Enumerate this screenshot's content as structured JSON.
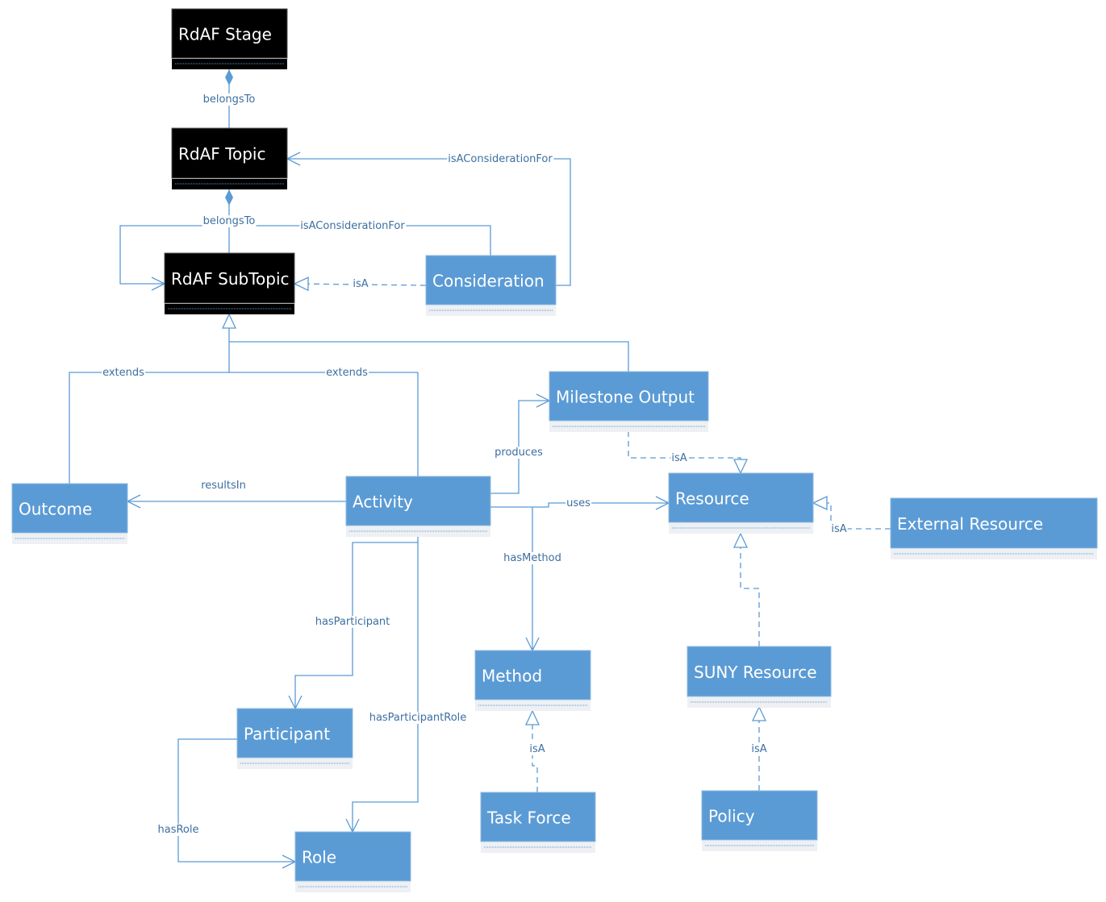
{
  "colors": {
    "dark_class": "#000000",
    "light_class": "#5b9bd5",
    "edge": "#5b9bd5",
    "label": "#3c6fa0"
  },
  "nodes": {
    "stage": {
      "name": "RdAF Stage",
      "style": "dark"
    },
    "topic": {
      "name": "RdAF Topic",
      "style": "dark"
    },
    "subtopic": {
      "name": "RdAF SubTopic",
      "style": "dark"
    },
    "consideration": {
      "name": "Consideration",
      "style": "light"
    },
    "milestone": {
      "name": "Milestone Output",
      "style": "light"
    },
    "outcome": {
      "name": "Outcome",
      "style": "light"
    },
    "activity": {
      "name": "Activity",
      "style": "light"
    },
    "resource": {
      "name": "Resource",
      "style": "light"
    },
    "external": {
      "name": "External Resource",
      "style": "light"
    },
    "method": {
      "name": "Method",
      "style": "light"
    },
    "suny": {
      "name": "SUNY Resource",
      "style": "light"
    },
    "participant": {
      "name": "Participant",
      "style": "light"
    },
    "taskforce": {
      "name": "Task Force",
      "style": "light"
    },
    "policy": {
      "name": "Policy",
      "style": "light"
    },
    "role": {
      "name": "Role",
      "style": "light"
    }
  },
  "edges": {
    "topic_stage": {
      "label": "belongsTo",
      "type": "composition"
    },
    "subtopic_topic": {
      "label": "belongsTo",
      "type": "composition"
    },
    "consid_topic": {
      "label": "isAConsiderationFor",
      "type": "association"
    },
    "consid_subtopic": {
      "label": "isAConsiderationFor",
      "type": "association"
    },
    "consid_isa": {
      "label": "isA",
      "type": "realization"
    },
    "outcome_extends": {
      "label": "extends",
      "type": "generalization"
    },
    "activity_extends": {
      "label": "extends",
      "type": "generalization"
    },
    "milestone_gen": {
      "label": "",
      "type": "generalization"
    },
    "resultsIn": {
      "label": "resultsIn",
      "type": "association"
    },
    "produces": {
      "label": "produces",
      "type": "association"
    },
    "uses": {
      "label": "uses",
      "type": "association"
    },
    "hasMethod": {
      "label": "hasMethod",
      "type": "association"
    },
    "milestone_isa": {
      "label": "isA",
      "type": "realization"
    },
    "external_isa": {
      "label": "isA",
      "type": "realization"
    },
    "suny_isa": {
      "label": "",
      "type": "realization"
    },
    "taskforce_isa": {
      "label": "isA",
      "type": "realization"
    },
    "policy_isa": {
      "label": "isA",
      "type": "realization"
    },
    "hasParticipant": {
      "label": "hasParticipant",
      "type": "association"
    },
    "hasParticipantRole": {
      "label": "hasParticipantRole",
      "type": "association"
    },
    "hasRole": {
      "label": "hasRole",
      "type": "association"
    }
  }
}
